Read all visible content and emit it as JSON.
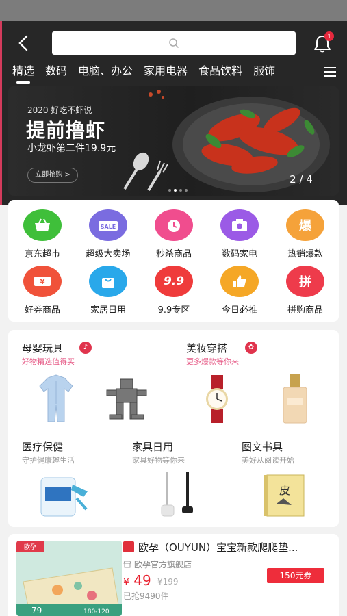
{
  "header": {
    "tabs": [
      "精选",
      "数码",
      "电脑、办公",
      "家用电器",
      "食品饮料",
      "服饰"
    ],
    "notification_count": "1"
  },
  "banner": {
    "subtitle": "2020 好吃不虾说",
    "title": "提前撸虾",
    "promo": "小龙虾第二件19.9元",
    "button": "立即抢购 >",
    "pager": "2 / 4"
  },
  "categories": [
    {
      "label": "京东超市",
      "color": "#3fbf3a"
    },
    {
      "label": "超级大卖场",
      "color": "#7a6ce0"
    },
    {
      "label": "秒杀商品",
      "color": "#f04d8e"
    },
    {
      "label": "数码家电",
      "color": "#9b5ae6"
    },
    {
      "label": "热销爆款",
      "color": "#f5a23a",
      "glyph": "爆"
    },
    {
      "label": "好券商品",
      "color": "#f0523a"
    },
    {
      "label": "家居日用",
      "color": "#29a8ea"
    },
    {
      "label": "9.9专区",
      "color": "#ef3b3b",
      "glyph": "9.9"
    },
    {
      "label": "今日必推",
      "color": "#f5a726"
    },
    {
      "label": "拼购商品",
      "color": "#ee3b4b",
      "glyph": "拼"
    }
  ],
  "sections": {
    "baby": {
      "title": "母婴玩具",
      "subtitle": "好物精选值得买"
    },
    "beauty": {
      "title": "美妆穿搭",
      "subtitle": "更多爆款等你来"
    },
    "medical": {
      "title": "医疗保健",
      "subtitle": "守护健康趣生活"
    },
    "home": {
      "title": "家具日用",
      "subtitle": "家具好物等你来"
    },
    "books": {
      "title": "图文书具",
      "subtitle": "美好从阅读开始"
    }
  },
  "product": {
    "title": "欧孕（OUYUN）宝宝新款爬爬垫...",
    "shop": "欧孕官方旗舰店",
    "price": "49",
    "currency": "¥",
    "orig_price": "¥199",
    "sold": "已抢9490件",
    "coupon": "150元券",
    "img_brand": "欧孕",
    "img_price": "79",
    "img_size": "180-120"
  }
}
